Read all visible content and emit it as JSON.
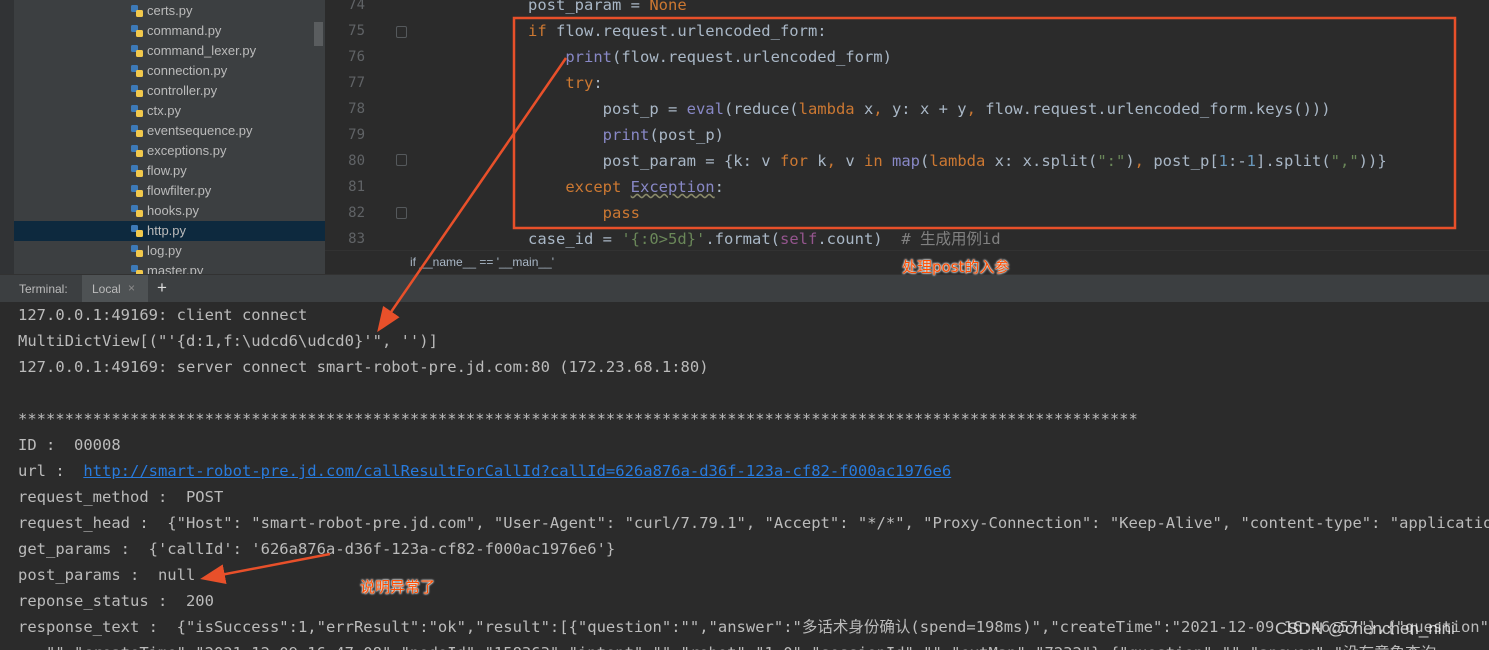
{
  "project_files": [
    {
      "name": "certs.py"
    },
    {
      "name": "command.py"
    },
    {
      "name": "command_lexer.py"
    },
    {
      "name": "connection.py"
    },
    {
      "name": "controller.py"
    },
    {
      "name": "ctx.py"
    },
    {
      "name": "eventsequence.py"
    },
    {
      "name": "exceptions.py"
    },
    {
      "name": "flow.py"
    },
    {
      "name": "flowfilter.py"
    },
    {
      "name": "hooks.py"
    },
    {
      "name": "http.py",
      "selected": true
    },
    {
      "name": "log.py"
    },
    {
      "name": "master.py"
    }
  ],
  "editor": {
    "line_numbers": [
      "74",
      "75",
      "76",
      "77",
      "78",
      "79",
      "80",
      "81",
      "82",
      "83"
    ],
    "breadcrumb": "if __name__ == '__main__'"
  },
  "terminal": {
    "title": "Terminal:",
    "tab_label": "Local",
    "close_glyph": "×",
    "add_glyph": "+",
    "lines": {
      "l1": "127.0.0.1:49169: client connect",
      "l2": "MultiDictView[(\"'{d:1,f:\\udcd6\\udcd0}'\", '')]",
      "l3": "127.0.0.1:49169: server connect smart-robot-pre.jd.com:80 (172.23.68.1:80)",
      "stars": "************************************************************************************************************************",
      "id": "ID :  00008",
      "url_label": "url :  ",
      "url": "http://smart-robot-pre.jd.com/callResultForCallId?callId=626a876a-d36f-123a-cf82-f000ac1976e6",
      "request_method": "request_method :  POST",
      "request_head": "request_head :  {\"Host\": \"smart-robot-pre.jd.com\", \"User-Agent\": \"curl/7.79.1\", \"Accept\": \"*/*\", \"Proxy-Connection\": \"Keep-Alive\", \"content-type\": \"application/json",
      "get_params": "get_params :  {'callId': '626a876a-d36f-123a-cf82-f000ac1976e6'}",
      "post_params": "post_params :  null",
      "reponse_status": "reponse_status :  200",
      "response_text": "response_text :  {\"isSuccess\":1,\"errResult\":\"ok\",\"result\":[{\"question\":\"\",\"answer\":\"多话术身份确认(spend=198ms)\",\"createTime\":\"2021-12-09 16:46:57\"},{\"question\":\"怎",
      "last": "...\"\",\"createTime\":\"2021-12-09 16:47:08\",\"nodeId\":\"158363\",\"intent\":\"\",\"robot\":\"1.0\",\"sessionId\":\"\",\"extMap\":\"7232\"},{\"question\":\"\",\"answer\":\"没有意象查询"
    }
  },
  "annotations": {
    "note_post": "处理post的入参",
    "note_null": "说明异常了",
    "color": "#e8502a"
  },
  "watermark": "CSDN @chenchen_nini",
  "colors": {
    "keyword": "#cc7832",
    "builtin": "#8888c6",
    "string": "#6a8759",
    "number": "#6897bb",
    "self": "#94558d",
    "link": "#287bde"
  }
}
